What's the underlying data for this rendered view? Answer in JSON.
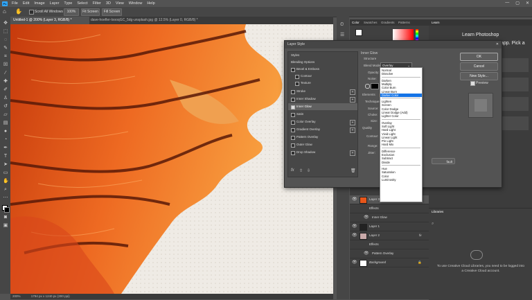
{
  "menu": [
    "File",
    "Edit",
    "Image",
    "Layer",
    "Type",
    "Select",
    "Filter",
    "3D",
    "View",
    "Window",
    "Help"
  ],
  "app_logo": "Ps",
  "window_controls": [
    "—",
    "▢",
    "✕"
  ],
  "options_bar": {
    "scroll_all_windows": "Scroll All Windows",
    "zoom_value": "100%",
    "fit_screen": "Fit Screen",
    "fill_screen": "Fill Screen"
  },
  "doc_tabs": [
    {
      "label": "Untitled-1 @ 200% (Layer 3, RGB/8) *"
    },
    {
      "label": "dave-hoefler-loooqGC_5dg-unsplash.jpg @ 12.5% (Layer 0, RGB/8) *"
    }
  ],
  "status_bar": {
    "zoom": "200%",
    "info": "1794 px x 1240 px (300 ppi)"
  },
  "panels": {
    "color_tabs": [
      "Color",
      "Swatches",
      "Gradients",
      "Patterns"
    ],
    "learn_tab": "Learn",
    "learn_title": "Learn Photoshop",
    "learn_sub": "app. Pick a",
    "libraries_tab": "Libraries",
    "libraries_msg": "To use Creative Cloud Libraries, you need to be logged into a Creative Cloud account."
  },
  "layers": [
    {
      "name": "Layer 3",
      "fx": "fx"
    },
    {
      "name": "Effects"
    },
    {
      "name": "Inner Glow"
    },
    {
      "name": "Layer 1"
    },
    {
      "name": "Layer 2",
      "fx": "fx"
    },
    {
      "name": "Effects"
    },
    {
      "name": "Pattern Overlay"
    },
    {
      "name": "Background"
    }
  ],
  "dialog": {
    "title": "Layer Style",
    "close": "✕",
    "styles_header": "Styles",
    "blending_options": "Blending Options",
    "style_items": [
      {
        "label": "Bevel & Emboss",
        "checked": false,
        "plus": false
      },
      {
        "label": "Contour",
        "checked": false,
        "plus": false
      },
      {
        "label": "Texture",
        "checked": false,
        "plus": false
      },
      {
        "label": "Stroke",
        "checked": false,
        "plus": true
      },
      {
        "label": "Inner Shadow",
        "checked": false,
        "plus": true
      },
      {
        "label": "Inner Glow",
        "checked": true,
        "plus": false
      },
      {
        "label": "Satin",
        "checked": false,
        "plus": false
      },
      {
        "label": "Color Overlay",
        "checked": false,
        "plus": true
      },
      {
        "label": "Gradient Overlay",
        "checked": false,
        "plus": true
      },
      {
        "label": "Pattern Overlay",
        "checked": false,
        "plus": false
      },
      {
        "label": "Outer Glow",
        "checked": false,
        "plus": false
      },
      {
        "label": "Drop Shadow",
        "checked": false,
        "plus": true
      }
    ],
    "section_title": "Inner Glow",
    "structure": "Structure",
    "blend_mode_label": "Blend Mode:",
    "blend_mode_value": "Overlay",
    "opacity_label": "Opacity:",
    "noise_label": "Noise:",
    "elements": "Elements",
    "technique": "Technique:",
    "source": "Source:",
    "choke": "Choke:",
    "size": "Size:",
    "quality": "Quality",
    "contour": "Contour:",
    "range": "Range:",
    "jitter": "Jitter:",
    "default_btn": "fault",
    "ok": "OK",
    "cancel": "Cancel",
    "new_style": "New Style...",
    "preview": "Preview"
  },
  "blend_modes": [
    [
      "Normal",
      "Dissolve"
    ],
    [
      "Darken",
      "Multiply",
      "Color Burn",
      "Linear Burn",
      "Darker Color"
    ],
    [
      "Lighten",
      "Screen",
      "Color Dodge",
      "Linear Dodge (Add)",
      "Lighter Color"
    ],
    [
      "Overlay",
      "Soft Light",
      "Hard Light",
      "Vivid Light",
      "Linear Light",
      "Pin Light",
      "Hard Mix"
    ],
    [
      "Difference",
      "Exclusion",
      "Subtract",
      "Divide"
    ],
    [
      "Hue",
      "Saturation",
      "Color",
      "Luminosity"
    ]
  ],
  "blend_mode_highlight": "Darker Color",
  "colors": {
    "accent": "#31a8ff",
    "highlight": "#1473e6",
    "flame": "#e8561a"
  }
}
